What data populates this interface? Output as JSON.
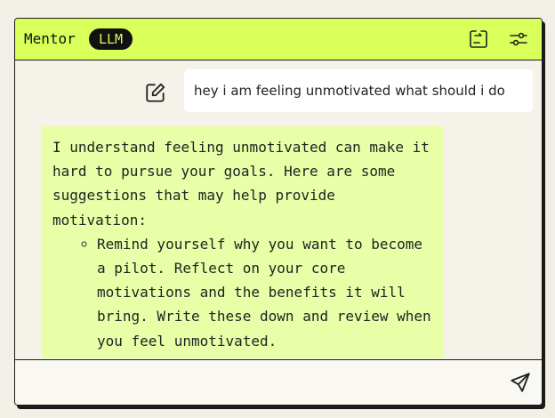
{
  "header": {
    "title": "Mentor",
    "badge": "LLM",
    "icons": [
      "swap-icon",
      "settings-sliders-icon"
    ],
    "accent_color": "#d8ff5a"
  },
  "chat": {
    "user_message": "hey i am feeling unmotivated what should i do",
    "assistant_intro": "I understand feeling unmotivated can make it hard to pursue your goals. Here are some suggestions that may help provide motivation:",
    "assistant_items": [
      "Remind yourself why you want to become a pilot. Reflect on your core motivations and the benefits it will bring. Write these down and review when you feel unmotivated."
    ],
    "assistant_bubble_color": "#e8ffa8",
    "user_bubble_color": "#ffffff"
  },
  "composer": {
    "value": "",
    "placeholder": "",
    "send_icon": "send-icon"
  }
}
